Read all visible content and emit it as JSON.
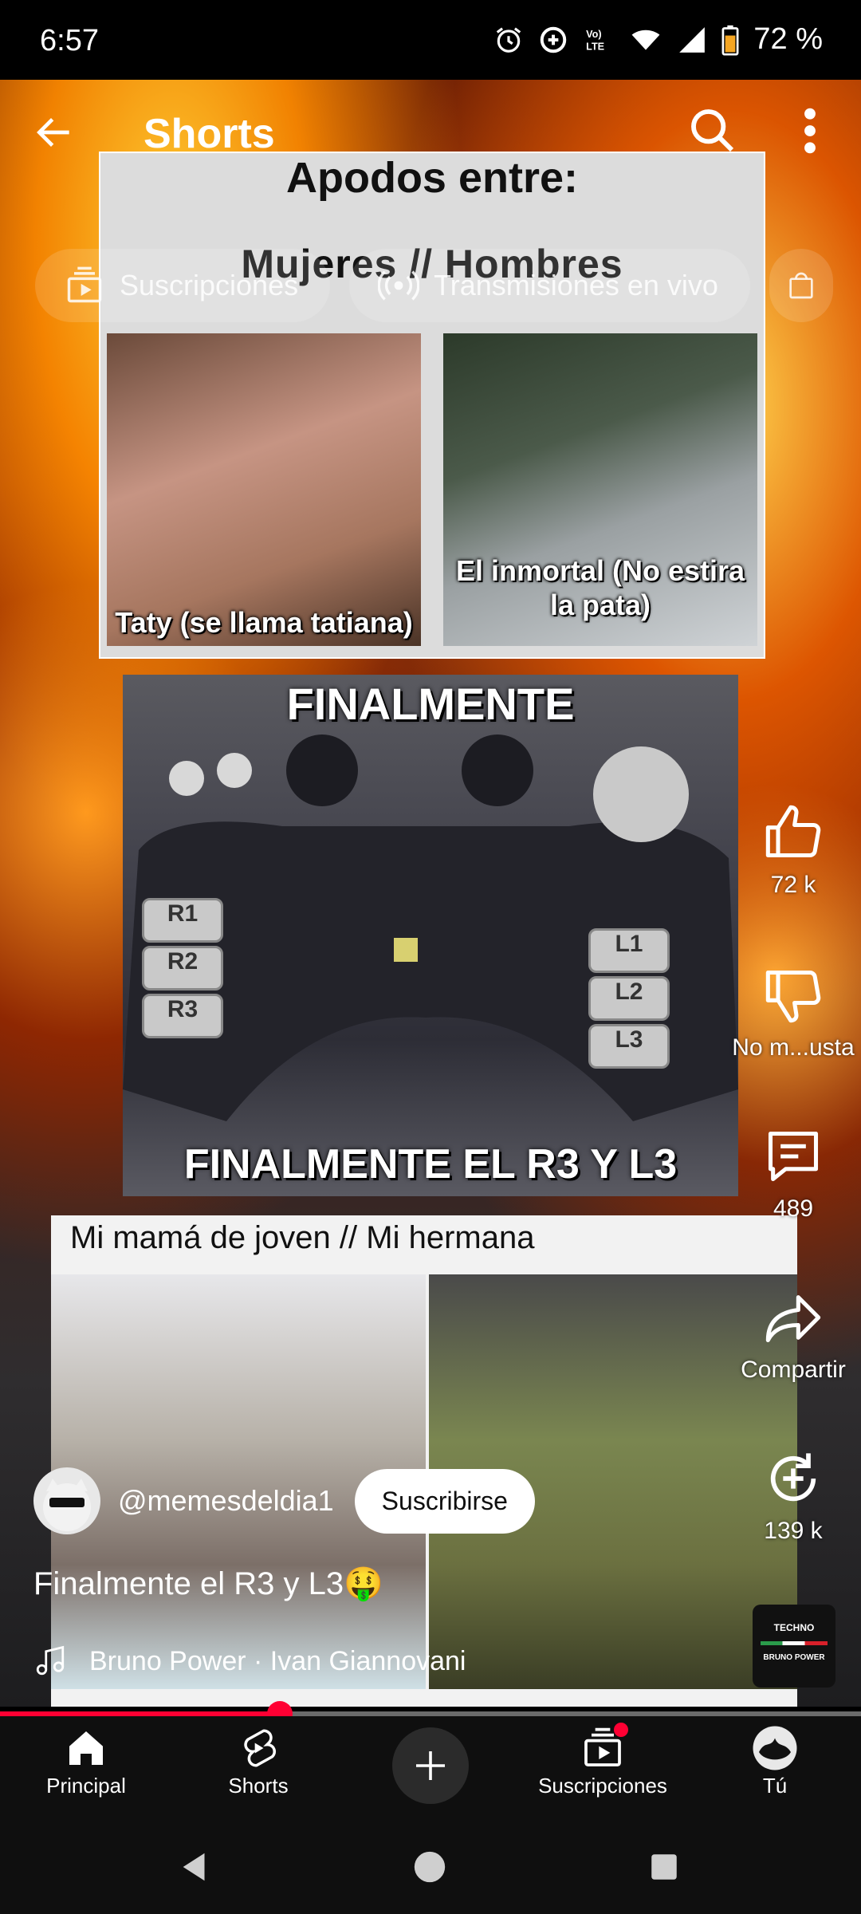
{
  "status_bar": {
    "time": "6:57",
    "battery_pct": "72 %",
    "icons": [
      "alarm-icon",
      "data-saver-icon",
      "volte-icon",
      "wifi-icon",
      "signal-icon",
      "battery-icon"
    ]
  },
  "header": {
    "title": "Shorts",
    "back_icon": "back-arrow-icon",
    "search_icon": "search-icon",
    "more_icon": "more-vert-icon"
  },
  "chips": [
    {
      "label": "Suscripciones",
      "icon": "subscriptions-icon"
    },
    {
      "label": "Transmisiones en vivo",
      "icon": "live-icon"
    },
    {
      "label": "",
      "icon": "shopping-bag-icon"
    }
  ],
  "video_text": {
    "panel1_title": "Apodos entre:",
    "panel1_sub": "Mujeres  //  Hombres",
    "panel1_left_caption": "Taty (se llama tatiana)",
    "panel1_right_caption": "El inmortal (No estira la pata)",
    "panel2_top": "FINALMENTE",
    "panel2_bottom": "FINALMENTE EL R3 Y L3",
    "pad_left": [
      "R1",
      "R2",
      "R3"
    ],
    "pad_right": [
      "L1",
      "L2",
      "L3"
    ],
    "panel3_header": "Mi mamá de joven // Mi hermana"
  },
  "actions": {
    "like_count": "72 k",
    "dislike_label": "No m...usta",
    "comments_count": "489",
    "share_label": "Compartir",
    "remix_count": "139 k"
  },
  "channel": {
    "handle": "@memesdeldia1",
    "subscribe_label": "Suscribirse"
  },
  "caption": "Finalmente el R3 y L3🤑",
  "music": {
    "text": "Bruno Power · Ivan Giannovani",
    "thumb_line1": "TECHNO",
    "thumb_line2": "BRUNO POWER"
  },
  "playback": {
    "progress": 0.325
  },
  "nav": {
    "home": "Principal",
    "shorts": "Shorts",
    "subscriptions": "Suscripciones",
    "you": "Tú"
  },
  "colors": {
    "accent": "#ff0033",
    "nav_bg": "#0f0f0f"
  }
}
